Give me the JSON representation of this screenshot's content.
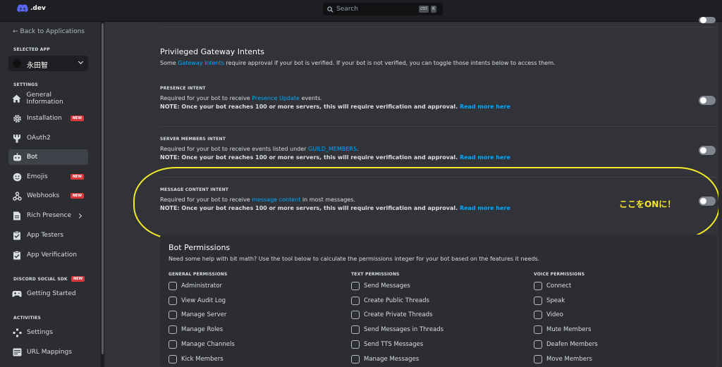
{
  "topbar": {
    "logo_text": ".dev",
    "search_placeholder": "Search",
    "kbd1": "ctrl",
    "kbd2": "K"
  },
  "sidebar": {
    "back": "← Back to Applications",
    "selected_app_heading": "SELECTED APP",
    "app_name": "永田智",
    "settings_heading": "SETTINGS",
    "items": [
      {
        "label": "General Information",
        "icon": "home-icon"
      },
      {
        "label": "Installation",
        "icon": "gear-icon",
        "badge": "NEW"
      },
      {
        "label": "OAuth2",
        "icon": "wrench-icon"
      },
      {
        "label": "Bot",
        "icon": "bot-icon"
      },
      {
        "label": "Emojis",
        "icon": "emoji-icon",
        "badge": "NEW"
      },
      {
        "label": "Webhooks",
        "icon": "webhook-icon",
        "badge": "NEW"
      },
      {
        "label": "Rich Presence",
        "icon": "rich-presence-icon"
      },
      {
        "label": "App Testers",
        "icon": "testers-icon"
      },
      {
        "label": "App Verification",
        "icon": "verification-icon"
      }
    ],
    "social_heading": "DISCORD SOCIAL SDK",
    "social_badge": "NEW",
    "getting_started": "Getting Started",
    "activities_heading": "ACTIVITIES",
    "activities": [
      {
        "label": "Settings",
        "icon": "settings-icon"
      },
      {
        "label": "URL Mappings",
        "icon": "url-mappings-icon"
      }
    ]
  },
  "main": {
    "intents_title": "Privileged Gateway Intents",
    "intents_sub_pre": "Some ",
    "intents_sub_link": "Gateway Intents",
    "intents_sub_post": " require approval if your bot is verified. If your bot is not verified, you can toggle those intents below to access them.",
    "intents": [
      {
        "title": "PRESENCE INTENT",
        "desc_pre": "Required for your bot to receive ",
        "desc_link": "Presence Update",
        "desc_post": " events.",
        "note": "NOTE: Once your bot reaches 100 or more servers, this will require verification and approval.",
        "note_link": "Read more here",
        "enabled": false
      },
      {
        "title": "SERVER MEMBERS INTENT",
        "desc_pre": "Required for your bot to receive events listed under ",
        "desc_link": "GUILD_MEMBERS",
        "desc_post": ".",
        "note": "NOTE: Once your bot reaches 100 or more servers, this will require verification and approval.",
        "note_link": "Read more here",
        "enabled": false
      },
      {
        "title": "MESSAGE CONTENT INTENT",
        "desc_pre": "Required for your bot to receive ",
        "desc_link": "message content",
        "desc_post": " in most messages.",
        "note": "NOTE: Once your bot reaches 100 or more servers, this will require verification and approval.",
        "note_link": "Read more here",
        "enabled": false
      }
    ],
    "annotation": "ここをONに！",
    "permissions": {
      "title": "Bot Permissions",
      "sub": "Need some help with bit math? Use the tool below to calculate the permissions integer for your bot based on the features it needs.",
      "columns": [
        {
          "heading": "GENERAL PERMISSIONS",
          "items": [
            "Administrator",
            "View Audit Log",
            "Manage Server",
            "Manage Roles",
            "Manage Channels",
            "Kick Members"
          ]
        },
        {
          "heading": "TEXT PERMISSIONS",
          "items": [
            "Send Messages",
            "Create Public Threads",
            "Create Private Threads",
            "Send Messages in Threads",
            "Send TTS Messages",
            "Manage Messages"
          ]
        },
        {
          "heading": "VOICE PERMISSIONS",
          "items": [
            "Connect",
            "Speak",
            "Video",
            "Mute Members",
            "Deafen Members",
            "Move Members"
          ]
        }
      ]
    }
  },
  "colors": {
    "accent": "#5865f2",
    "link": "#00a8fc",
    "annotation": "#f2ea28",
    "badge": "#da373c"
  }
}
